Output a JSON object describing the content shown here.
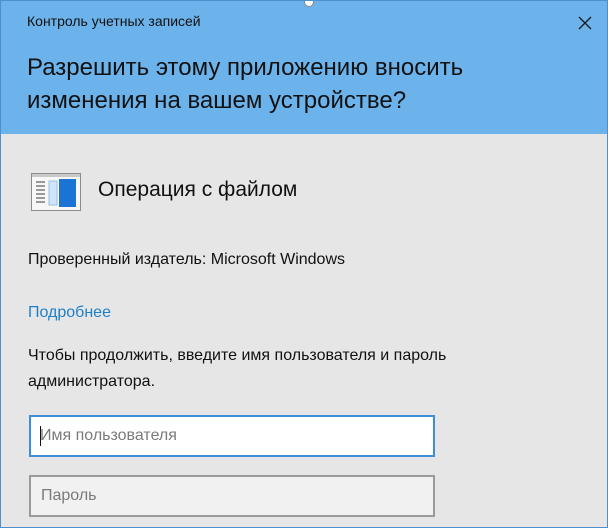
{
  "window": {
    "title": "Контроль учетных записей",
    "close_icon": "close-icon"
  },
  "prompt": {
    "question": "Разрешить этому приложению вносить изменения на вашем устройстве?"
  },
  "app": {
    "icon": "file-operation-icon",
    "name": "Операция с файлом",
    "publisher": "Проверенный издатель: Microsoft Windows",
    "details_link": "Подробнее"
  },
  "credentials": {
    "instruction": "Чтобы продолжить, введите имя пользователя и пароль администратора.",
    "username_placeholder": "Имя пользователя",
    "username_value": "",
    "password_placeholder": "Пароль",
    "password_value": ""
  },
  "colors": {
    "header_bg": "#6cb3eb",
    "body_bg": "#e6e6e6",
    "link": "#1f7fc8",
    "focus_border": "#3c8fd6"
  }
}
